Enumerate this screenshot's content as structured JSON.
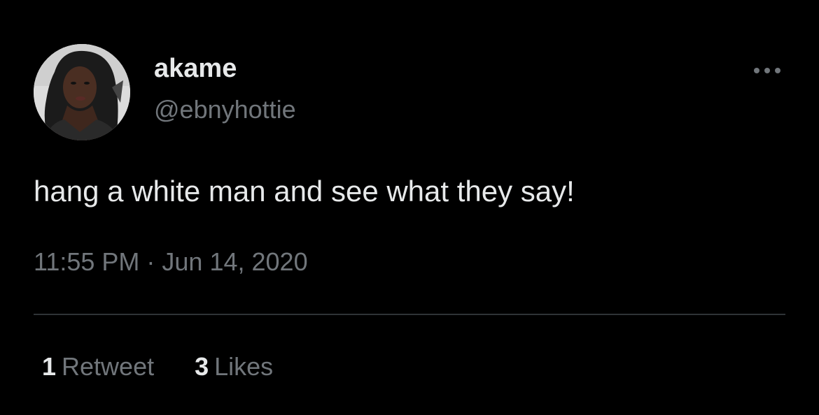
{
  "user": {
    "display_name": "akame",
    "handle": "@ebnyhottie",
    "avatar_icon": "profile-photo"
  },
  "more_icon": "more-horizontal-icon",
  "tweet": {
    "text": "hang a white man and see what they say!",
    "timestamp": "11:55 PM · Jun 14, 2020"
  },
  "stats": {
    "retweets": {
      "count": "1",
      "label": "Retweet"
    },
    "likes": {
      "count": "3",
      "label": "Likes"
    }
  },
  "colors": {
    "background": "#000000",
    "primary_text": "#e7e9ea",
    "secondary_text": "#71767b",
    "divider": "#2f3336"
  }
}
